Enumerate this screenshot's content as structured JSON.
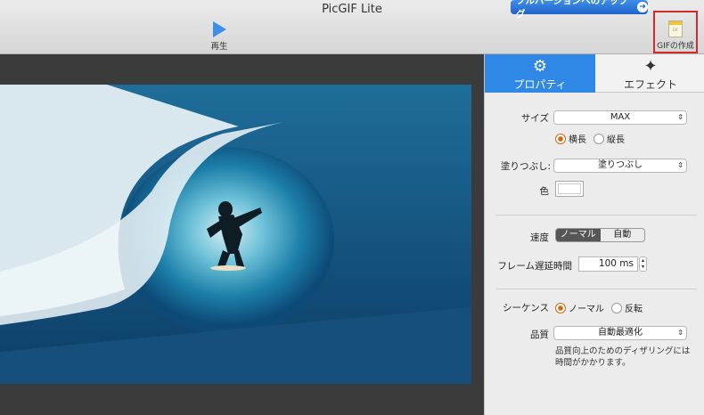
{
  "window": {
    "title": "PicGIF Lite"
  },
  "toolbar": {
    "upgrade_label": "フルバージョンへのアップグ",
    "play_label": "再生",
    "make_gif_label": "GIFの作成",
    "make_gif_doc_text": "GIF"
  },
  "tabs": [
    {
      "label": "プロパティ",
      "icon": "gear-icon",
      "active": true
    },
    {
      "label": "エフェクト",
      "icon": "magic-wand-icon",
      "active": false
    }
  ],
  "properties": {
    "size": {
      "label": "サイズ",
      "value": "MAX"
    },
    "orientation": {
      "options": [
        "横長",
        "縦長"
      ],
      "selected": "横長"
    },
    "fill": {
      "label": "塗りつぶし:",
      "value": "塗りつぶし"
    },
    "color": {
      "label": "色",
      "value": "#ffffff"
    },
    "speed": {
      "label": "速度",
      "options": [
        "ノーマル",
        "自動"
      ],
      "selected": "ノーマル"
    },
    "frame_delay": {
      "label": "フレーム遅延時間",
      "value": "100 ms"
    },
    "sequence": {
      "label": "シーケンス",
      "options": [
        "ノーマル",
        "反転"
      ],
      "selected": "ノーマル"
    },
    "quality": {
      "label": "品質",
      "value": "自動最適化"
    },
    "note": "品質向上のためのディザリングには時間がかかります。"
  },
  "colors": {
    "accent": "#2f87e6",
    "highlight_border": "#d42a2a",
    "radio_on": "#c46a18"
  }
}
